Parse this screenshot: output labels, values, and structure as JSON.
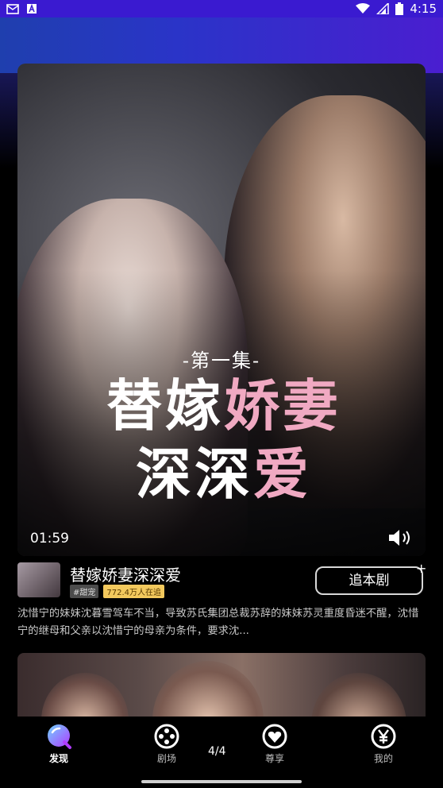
{
  "status_bar": {
    "time": "4:15"
  },
  "video": {
    "episode_label": "-第一集-",
    "poster_title_line1_a": "替嫁",
    "poster_title_line1_b": "娇妻",
    "poster_title_line2_a": "深深",
    "poster_title_line2_b": "爱",
    "current_time": "01:59"
  },
  "drama": {
    "title": "替嫁娇妻深深爱",
    "tags": [
      "#甜宠",
      "772.4万人在追"
    ],
    "follow_label": "追本剧",
    "description": "沈惜宁的妹妹沈暮雪驾车不当，导致苏氏集团总裁苏辞的妹妹苏灵重度昏迷不醒，沈惜宁的继母和父亲以沈惜宁的母亲为条件，要求沈..."
  },
  "tabs": [
    {
      "label": "发现",
      "icon": "discover-icon",
      "active": true
    },
    {
      "label": "剧场",
      "icon": "film-reel-icon",
      "active": false
    },
    {
      "label": "尊享",
      "icon": "heart-badge-icon",
      "active": false
    },
    {
      "label": "我的",
      "icon": "yen-icon",
      "active": false
    }
  ],
  "page_indicator": "4/4",
  "colors": {
    "status_bar": "#3a1ad0",
    "accent_pink": "#f0a9c2",
    "tag_followers": "#f3c95d"
  }
}
